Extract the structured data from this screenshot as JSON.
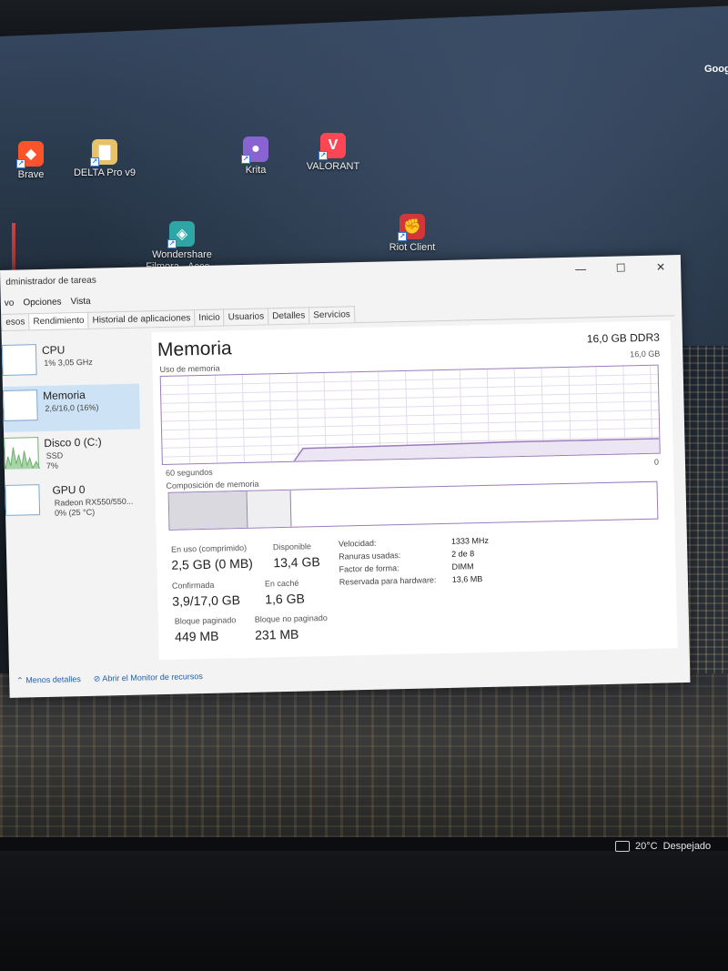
{
  "desktop": {
    "icons": [
      {
        "name": "Brave",
        "color": "#fb542b"
      },
      {
        "name": "DELTA Pro v9",
        "color": "#e6c36a"
      },
      {
        "name": "Krita",
        "color": "#8a63d2"
      },
      {
        "name": "VALORANT",
        "color": "#ff4655"
      },
      {
        "name": "Wondershare\nFilmora - Acce...",
        "color": "#2ea6a6"
      },
      {
        "name": "Riot Client",
        "color": "#d13639"
      }
    ],
    "edge_label": "Goog"
  },
  "task_manager": {
    "title": "dministrador de tareas",
    "window_buttons": [
      "—",
      "☐",
      "✕"
    ],
    "menu": [
      "vo",
      "Opciones",
      "Vista"
    ],
    "tabs": [
      "esos",
      "Rendimiento",
      "Historial de aplicaciones",
      "Inicio",
      "Usuarios",
      "Detalles",
      "Servicios"
    ],
    "active_tab": "Rendimiento",
    "sidebar": [
      {
        "name": "CPU",
        "sub": "1% 3,05 GHz"
      },
      {
        "name": "Memoria",
        "sub": "2,6/16,0 (16%)"
      },
      {
        "name": "Disco 0 (C:)",
        "sub": "SSD\n7%"
      },
      {
        "name": "GPU 0",
        "sub": "Radeon RX550/550...\n0% (25 °C)"
      }
    ],
    "panel": {
      "title": "Memoria",
      "type": "16,0 GB DDR3",
      "usage_label": "Uso de memoria",
      "usage_max": "16,0 GB",
      "graph_left": "60 segundos",
      "graph_right": "0",
      "composition_label": "Composición de memoria",
      "composition": {
        "in_use_fraction": 0.16,
        "modified_fraction": 0.09
      },
      "stats": {
        "in_use_label": "En uso (comprimido)",
        "in_use_value": "2,5 GB (0 MB)",
        "available_label": "Disponible",
        "available_value": "13,4 GB",
        "committed_label": "Confirmada",
        "committed_value": "3,9/17,0 GB",
        "cached_label": "En caché",
        "cached_value": "1,6 GB",
        "paged_label": "Bloque paginado",
        "paged_value": "449 MB",
        "nonpaged_label": "Bloque no paginado",
        "nonpaged_value": "231 MB"
      },
      "details": [
        {
          "label": "Velocidad:",
          "value": "1333 MHz"
        },
        {
          "label": "Ranuras usadas:",
          "value": "2 de 8"
        },
        {
          "label": "Factor de forma:",
          "value": "DIMM"
        },
        {
          "label": "Reservada para hardware:",
          "value": "13,6 MB"
        }
      ]
    },
    "links": {
      "fewer": "Menos detalles",
      "monitor": "Abrir el Monitor de recursos"
    }
  },
  "taskbar": {
    "temperature": "20°C",
    "condition": "Despejado"
  },
  "colors": {
    "accent": "#9a7cba",
    "selection": "#cde3f5"
  }
}
